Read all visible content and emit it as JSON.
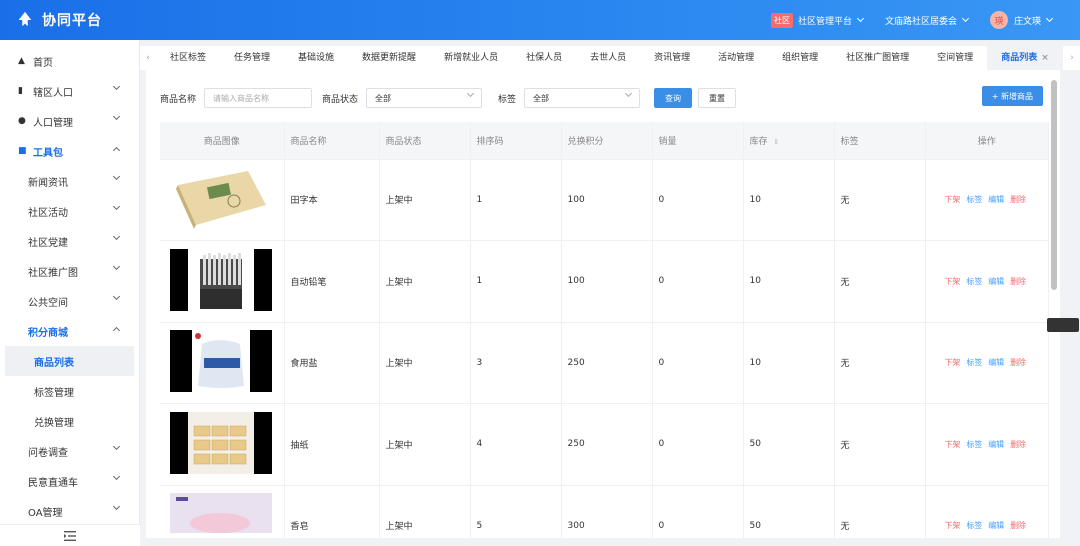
{
  "header": {
    "logo_text": "协同平台",
    "platform_badge": "社区",
    "platform_name": "社区管理平台",
    "community": "文庙路社区居委会",
    "avatar_char": "瑛",
    "user_name": "庄文瑛"
  },
  "sidebar": {
    "items": [
      {
        "label": "首页"
      },
      {
        "label": "辖区人口"
      },
      {
        "label": "人口管理"
      },
      {
        "label": "工具包"
      },
      {
        "label": "新闻资讯"
      },
      {
        "label": "社区活动"
      },
      {
        "label": "社区党建"
      },
      {
        "label": "社区推广图"
      },
      {
        "label": "公共空间"
      },
      {
        "label": "积分商城"
      },
      {
        "label": "商品列表"
      },
      {
        "label": "标签管理"
      },
      {
        "label": "兑换管理"
      },
      {
        "label": "问卷调查"
      },
      {
        "label": "民意直通车"
      },
      {
        "label": "OA管理"
      }
    ]
  },
  "tabs": [
    {
      "label": "社区标签"
    },
    {
      "label": "任务管理"
    },
    {
      "label": "基础设施"
    },
    {
      "label": "数据更新提醒"
    },
    {
      "label": "新增就业人员"
    },
    {
      "label": "社保人员"
    },
    {
      "label": "去世人员"
    },
    {
      "label": "资讯管理"
    },
    {
      "label": "活动管理"
    },
    {
      "label": "组织管理"
    },
    {
      "label": "社区推广图管理"
    },
    {
      "label": "空间管理"
    },
    {
      "label": "商品列表"
    }
  ],
  "filters": {
    "name_label": "商品名称",
    "name_placeholder": "请输入商品名称",
    "status_label": "商品状态",
    "status_value": "全部",
    "tag_label": "标签",
    "tag_value": "全部",
    "query": "查询",
    "reset": "重置",
    "add": "+ 新增商品"
  },
  "table": {
    "headers": [
      "商品图像",
      "商品名称",
      "商品状态",
      "排序码",
      "兑换积分",
      "销量",
      "库存",
      "标签",
      "操作"
    ],
    "rows": [
      {
        "name": "田字本",
        "status": "上架中",
        "sort": "1",
        "points": "100",
        "sales": "0",
        "stock": "10",
        "tag": "无"
      },
      {
        "name": "自动铅笔",
        "status": "上架中",
        "sort": "1",
        "points": "100",
        "sales": "0",
        "stock": "10",
        "tag": "无"
      },
      {
        "name": "食用盐",
        "status": "上架中",
        "sort": "3",
        "points": "250",
        "sales": "0",
        "stock": "10",
        "tag": "无"
      },
      {
        "name": "抽纸",
        "status": "上架中",
        "sort": "4",
        "points": "250",
        "sales": "0",
        "stock": "50",
        "tag": "无"
      },
      {
        "name": "香皂",
        "status": "上架中",
        "sort": "5",
        "points": "300",
        "sales": "0",
        "stock": "50",
        "tag": "无"
      }
    ],
    "ops": {
      "off": "下架",
      "tag": "标签",
      "edit": "编辑",
      "delete": "删除"
    }
  },
  "colors": {
    "primary": "#1a6fe8",
    "danger": "#f56c6c",
    "link": "#409eff"
  }
}
